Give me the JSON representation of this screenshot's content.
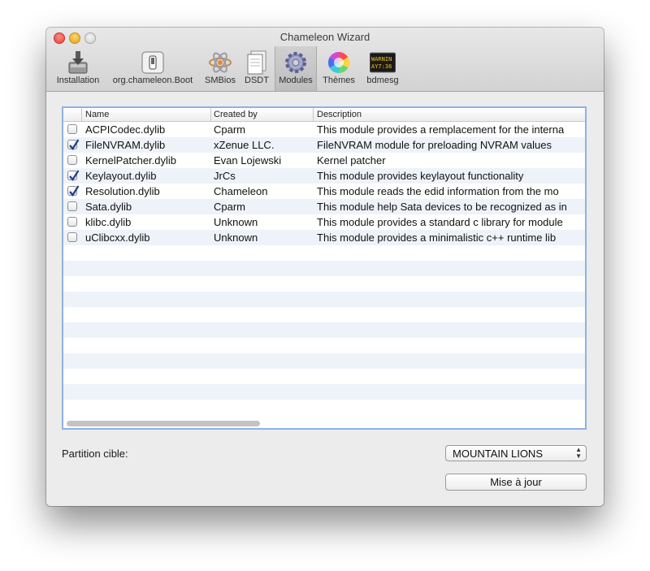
{
  "window": {
    "title": "Chameleon Wizard"
  },
  "toolbar": {
    "items": [
      {
        "label": "Installation",
        "icon": "installer-icon"
      },
      {
        "label": "org.chameleon.Boot",
        "icon": "switch-icon"
      },
      {
        "label": "SMBios",
        "icon": "atom-icon"
      },
      {
        "label": "DSDT",
        "icon": "documents-icon"
      },
      {
        "label": "Modules",
        "icon": "gear-icon",
        "selected": true
      },
      {
        "label": "Thèmes",
        "icon": "color-wheel-icon"
      },
      {
        "label": "bdmesg",
        "icon": "console-icon"
      }
    ]
  },
  "console_icon_text": {
    "line1": "WARNIN",
    "line2": "AY7:36"
  },
  "table": {
    "columns": [
      "Name",
      "Created by",
      "Description"
    ],
    "rows": [
      {
        "checked": false,
        "name": "ACPICodec.dylib",
        "author": "Cparm",
        "description": "This module provides a remplacement for the interna"
      },
      {
        "checked": true,
        "name": "FileNVRAM.dylib",
        "author": "xZenue LLC.",
        "description": "FileNVRAM module for preloading NVRAM values"
      },
      {
        "checked": false,
        "name": "KernelPatcher.dylib",
        "author": "Evan Lojewski",
        "description": "Kernel patcher"
      },
      {
        "checked": true,
        "name": "Keylayout.dylib",
        "author": "JrCs",
        "description": "This module provides keylayout functionality"
      },
      {
        "checked": true,
        "name": "Resolution.dylib",
        "author": "Chameleon",
        "description": "This module reads the edid information from the mo"
      },
      {
        "checked": false,
        "name": "Sata.dylib",
        "author": "Cparm",
        "description": "This module help Sata devices to be recognized as in"
      },
      {
        "checked": false,
        "name": "klibc.dylib",
        "author": "Unknown",
        "description": "This module provides a standard c library for module"
      },
      {
        "checked": false,
        "name": "uClibcxx.dylib",
        "author": "Unknown",
        "description": "This module provides a minimalistic c++ runtime lib"
      }
    ]
  },
  "partition": {
    "label": "Partition cible:",
    "selected": "MOUNTAIN LIONS"
  },
  "update_button": {
    "label": "Mise à jour"
  },
  "colors": {
    "table_border": "#8fb2e0",
    "row_alt": "#eef3fa",
    "checkbox_check": "#1c3f8f"
  }
}
